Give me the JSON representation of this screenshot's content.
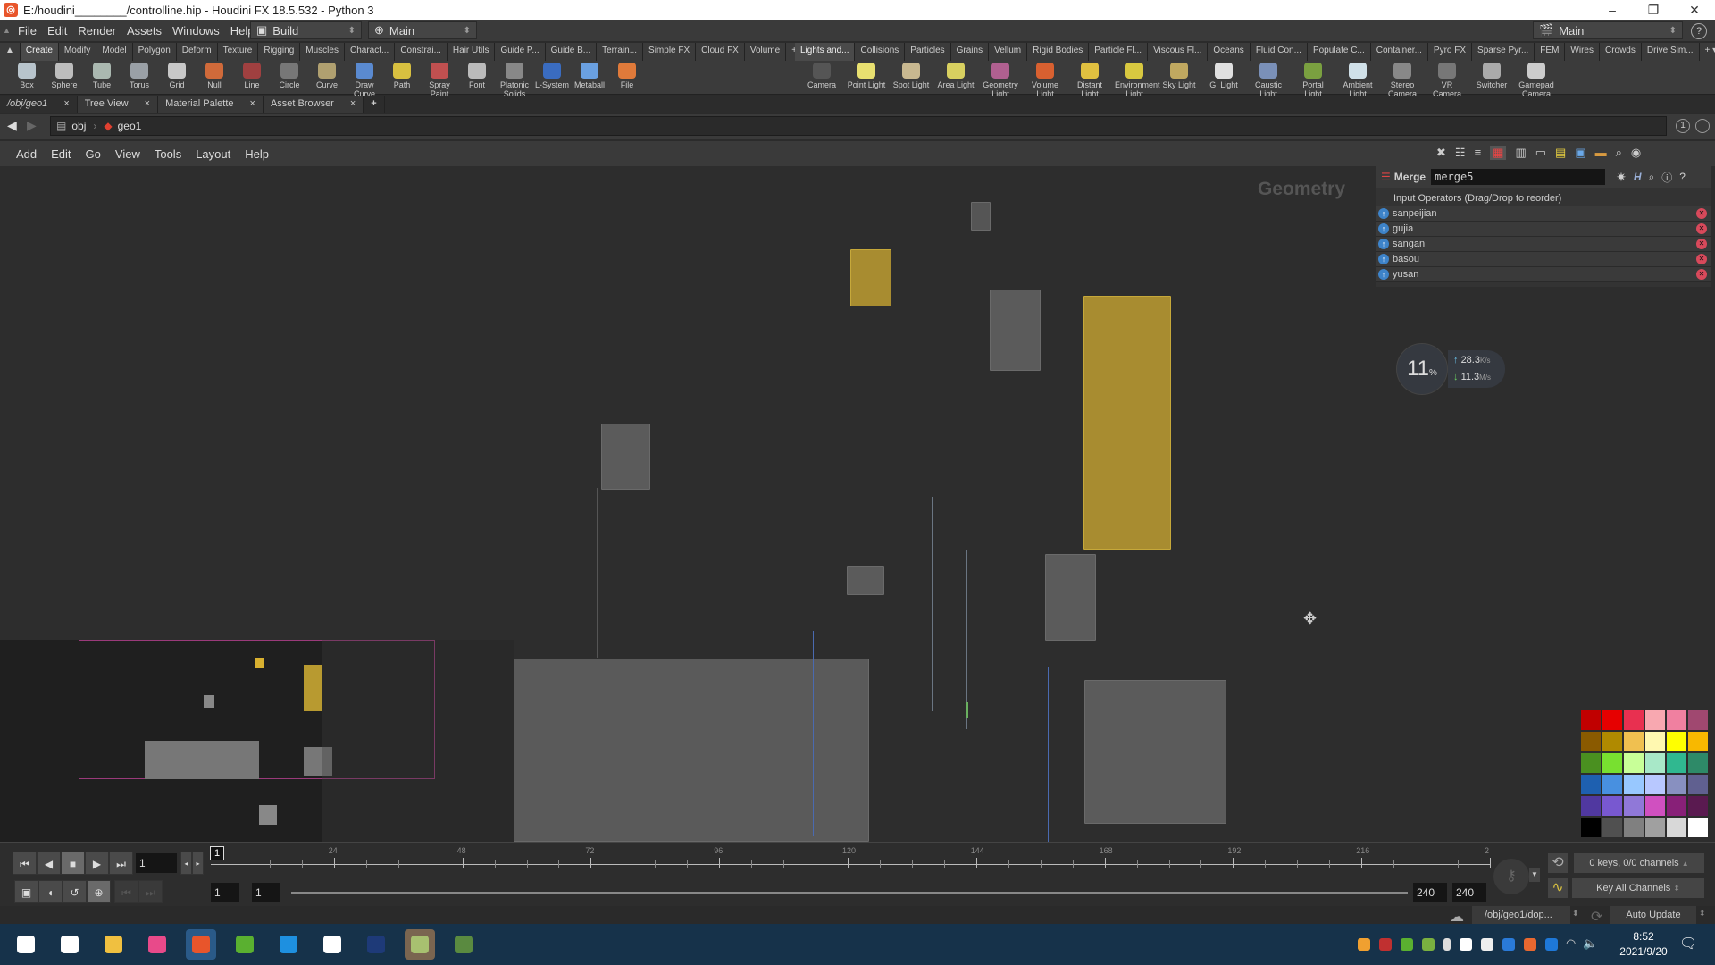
{
  "window": {
    "title": "E:/houdini________/controlline.hip - Houdini FX 18.5.532 - Python 3",
    "controls": [
      "–",
      "❐",
      "✕"
    ]
  },
  "menubar": {
    "items": [
      "File",
      "Edit",
      "Render",
      "Assets",
      "Windows",
      "Help"
    ],
    "desktop_dropdown": "Build",
    "context_dropdown": "Main",
    "right_dropdown": "Main"
  },
  "shelf_left": {
    "tabs": [
      "Create",
      "Modify",
      "Model",
      "Polygon",
      "Deform",
      "Texture",
      "Rigging",
      "Muscles",
      "Charact...",
      "Constrai...",
      "Hair Utils",
      "Guide P...",
      "Guide B...",
      "Terrain...",
      "Simple FX",
      "Cloud FX",
      "Volume"
    ],
    "active_tab": "Create",
    "tools": [
      {
        "label": "Box",
        "icon": "box-icon",
        "color": "#b8c4cc"
      },
      {
        "label": "Sphere",
        "icon": "sphere-icon",
        "color": "#bdbdbd"
      },
      {
        "label": "Tube",
        "icon": "tube-icon",
        "color": "#aab8b0"
      },
      {
        "label": "Torus",
        "icon": "torus-icon",
        "color": "#9aa0a6"
      },
      {
        "label": "Grid",
        "icon": "grid-icon",
        "color": "#c8c8c8"
      },
      {
        "label": "Null",
        "icon": "null-icon",
        "color": "#d06a3a"
      },
      {
        "label": "Line",
        "icon": "line-icon",
        "color": "#a04040"
      },
      {
        "label": "Circle",
        "icon": "circle-icon",
        "color": "#777"
      },
      {
        "label": "Curve",
        "icon": "curve-icon",
        "color": "#b0a070"
      },
      {
        "label": "Draw Curve",
        "icon": "draw-curve-icon",
        "color": "#5a8ad0"
      },
      {
        "label": "Path",
        "icon": "path-icon",
        "color": "#d8c040"
      },
      {
        "label": "Spray Paint",
        "icon": "spray-paint-icon",
        "color": "#c05050"
      },
      {
        "label": "Font",
        "icon": "font-icon",
        "color": "#bbbbbb"
      },
      {
        "label": "Platonic Solids",
        "icon": "platonic-solids-icon",
        "color": "#888"
      },
      {
        "label": "L-System",
        "icon": "l-system-icon",
        "color": "#3a6cc0"
      },
      {
        "label": "Metaball",
        "icon": "metaball-icon",
        "color": "#6aa0e0"
      },
      {
        "label": "File",
        "icon": "file-icon",
        "color": "#e07a3a"
      }
    ]
  },
  "shelf_right": {
    "tabs": [
      "Lights and...",
      "Collisions",
      "Particles",
      "Grains",
      "Vellum",
      "Rigid Bodies",
      "Particle Fl...",
      "Viscous Fl...",
      "Oceans",
      "Fluid Con...",
      "Populate C...",
      "Container...",
      "Pyro FX",
      "Sparse Pyr...",
      "FEM",
      "Wires",
      "Crowds",
      "Drive Sim..."
    ],
    "active_tab": "Lights and...",
    "tools": [
      {
        "label": "Camera",
        "icon": "camera-icon",
        "color": "#555"
      },
      {
        "label": "Point Light",
        "icon": "point-light-icon",
        "color": "#e8e070"
      },
      {
        "label": "Spot Light",
        "icon": "spot-light-icon",
        "color": "#c8b890"
      },
      {
        "label": "Area Light",
        "icon": "area-light-icon",
        "color": "#d8d060"
      },
      {
        "label": "Geometry Light",
        "icon": "geometry-light-icon",
        "color": "#b06090"
      },
      {
        "label": "Volume Light",
        "icon": "volume-light-icon",
        "color": "#d86030"
      },
      {
        "label": "Distant Light",
        "icon": "distant-light-icon",
        "color": "#e0c040"
      },
      {
        "label": "Environment Light",
        "icon": "environment-light-icon",
        "color": "#d8c840"
      },
      {
        "label": "Sky Light",
        "icon": "sky-light-icon",
        "color": "#c0a860"
      },
      {
        "label": "GI Light",
        "icon": "gi-light-icon",
        "color": "#e0e0e0"
      },
      {
        "label": "Caustic Light",
        "icon": "caustic-light-icon",
        "color": "#7a90b8"
      },
      {
        "label": "Portal Light",
        "icon": "portal-light-icon",
        "color": "#7aa040"
      },
      {
        "label": "Ambient Light",
        "icon": "ambient-light-icon",
        "color": "#d0e0e8"
      },
      {
        "label": "Stereo Camera",
        "icon": "stereo-camera-icon",
        "color": "#888"
      },
      {
        "label": "VR Camera",
        "icon": "vr-camera-icon",
        "color": "#777"
      },
      {
        "label": "Switcher",
        "icon": "switcher-icon",
        "color": "#aaa"
      },
      {
        "label": "Gamepad Camera",
        "icon": "gamepad-camera-icon",
        "color": "#ccc"
      }
    ]
  },
  "pane_tabs": [
    {
      "label": "/obj/geo1",
      "active": true
    },
    {
      "label": "Tree View"
    },
    {
      "label": "Material Palette"
    },
    {
      "label": "Asset Browser"
    }
  ],
  "path": {
    "crumbs": [
      "obj",
      "geo1"
    ]
  },
  "network_menu": [
    "Add",
    "Edit",
    "Go",
    "View",
    "Tools",
    "Layout",
    "Help"
  ],
  "network": {
    "context_label": "Geometry"
  },
  "params": {
    "node_type": "Merge",
    "node_name": "merge5",
    "list_header": "Input Operators (Drag/Drop to reorder)",
    "inputs": [
      "sanpeijian",
      "gujia",
      "sangan",
      "basou",
      "yusan"
    ]
  },
  "perf_widget": {
    "cpu_percent": "11",
    "percent_sign": "%",
    "upload": "28.3",
    "upload_unit": "K/s",
    "download": "11.3",
    "download_unit": "M/s"
  },
  "palette": {
    "colors": [
      "#c00000",
      "#e60000",
      "#e83050",
      "#f8a8b0",
      "#f080a0",
      "#a04870",
      "#8a5a00",
      "#b08a00",
      "#f0c050",
      "#fff8b0",
      "#ffff00",
      "#f8b800",
      "#4a9020",
      "#78e030",
      "#c8ff98",
      "#a8e8c8",
      "#30b890",
      "#2e8a68",
      "#1e60b0",
      "#4890e0",
      "#98c8ff",
      "#b8c8ff",
      "#8890c0",
      "#606090",
      "#5038a0",
      "#7858d0",
      "#9078d8",
      "#d050c0",
      "#882078",
      "#5a1a50",
      "#000000",
      "#505050",
      "#808080",
      "#a0a0a0",
      "#d8d8d8",
      "#ffffff"
    ]
  },
  "timeline": {
    "current_frame": "1",
    "frame_marker": "1",
    "ticks": [
      "24",
      "48",
      "72",
      "96",
      "120",
      "144",
      "168",
      "192",
      "216",
      "2"
    ],
    "range_start": "1",
    "range_start2": "1",
    "range_end": "240",
    "range_end2": "240",
    "keys_label": "0 keys, 0/0 channels",
    "key_all_label": "Key All Channels"
  },
  "statusbar": {
    "sim_path": "/obj/geo1/dop...",
    "update_mode": "Auto Update"
  },
  "taskbar": {
    "apps": [
      {
        "name": "start",
        "color": "#ffffff"
      },
      {
        "name": "search",
        "color": "#ffffff"
      },
      {
        "name": "file-explorer",
        "color": "#f0c040"
      },
      {
        "name": "chrome-like",
        "color": "#e84a8a"
      },
      {
        "name": "houdini",
        "color": "#e8552b"
      },
      {
        "name": "nvidia-tool",
        "color": "#5ab030"
      },
      {
        "name": "cloud-app",
        "color": "#1e90e0"
      },
      {
        "name": "baidu-netdisk",
        "color": "#ffffff"
      },
      {
        "name": "photoshop",
        "color": "#1e3a78"
      },
      {
        "name": "notes-app",
        "color": "#a8c070"
      },
      {
        "name": "tool-app",
        "color": "#5a8a40"
      }
    ],
    "clock_time": "8:52",
    "clock_date": "2021/9/20"
  }
}
